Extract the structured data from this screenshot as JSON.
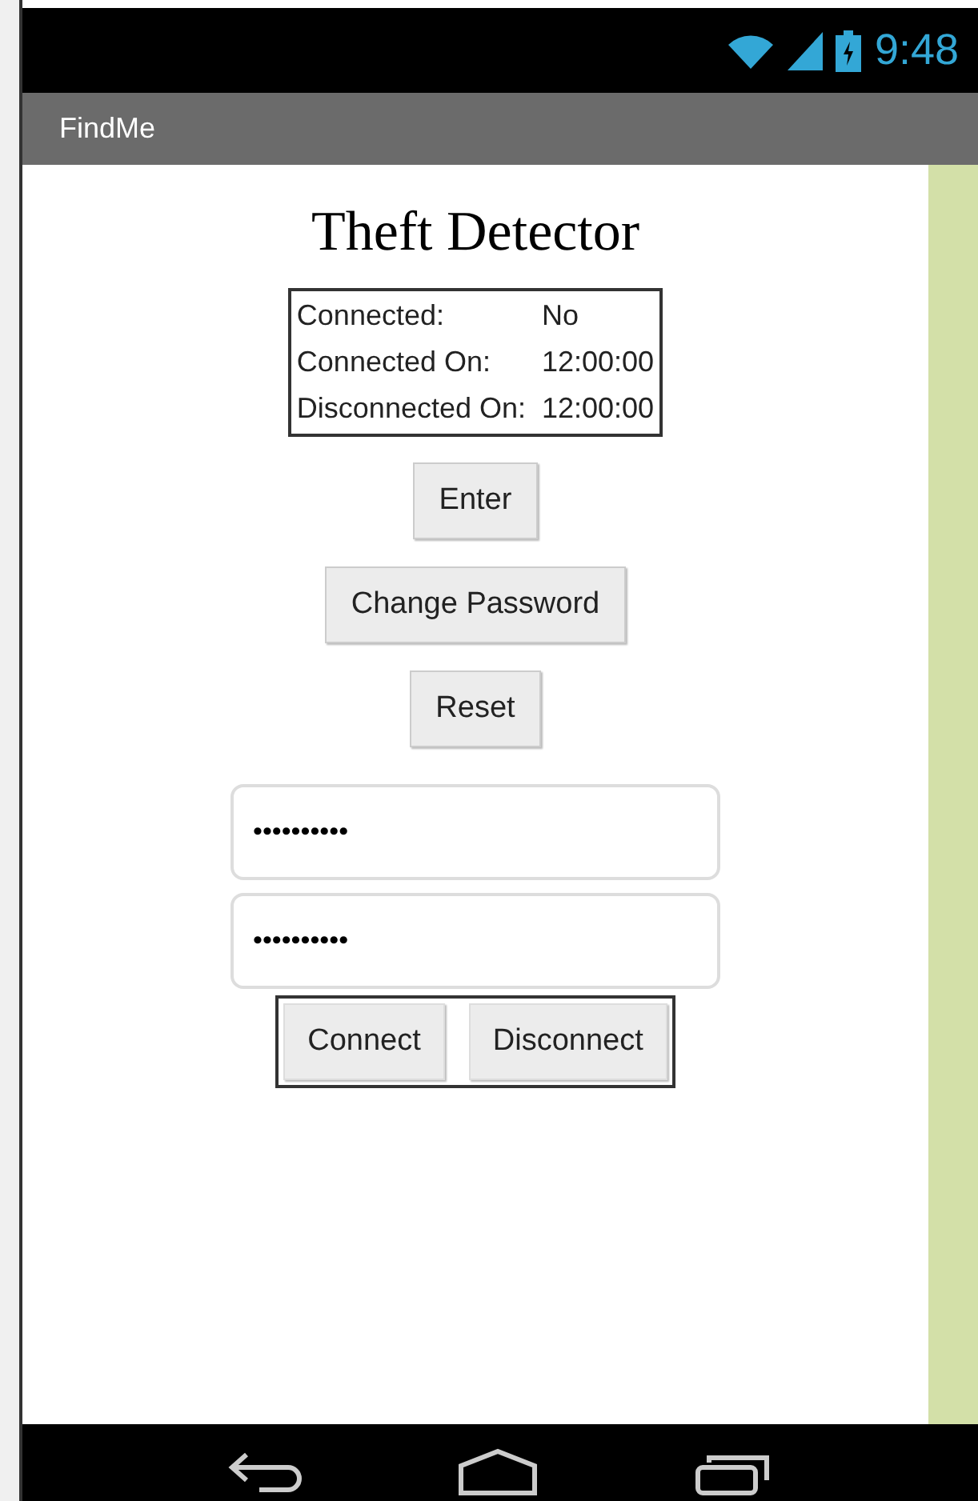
{
  "status_bar": {
    "time": "9:48"
  },
  "app_bar": {
    "title": "FindMe"
  },
  "title": "Theft Detector",
  "info": [
    {
      "label": "Connected:",
      "value": "No"
    },
    {
      "label": "Connected On:",
      "value": "12:00:00"
    },
    {
      "label": "Disconnected On:",
      "value": "12:00:00"
    }
  ],
  "buttons": [
    "Enter",
    "Change Password",
    "Reset"
  ],
  "password_fields": [
    {
      "value": "••••••••••"
    },
    {
      "value": "••••••••••"
    }
  ],
  "connection_buttons": [
    "Connect",
    "Disconnect"
  ]
}
